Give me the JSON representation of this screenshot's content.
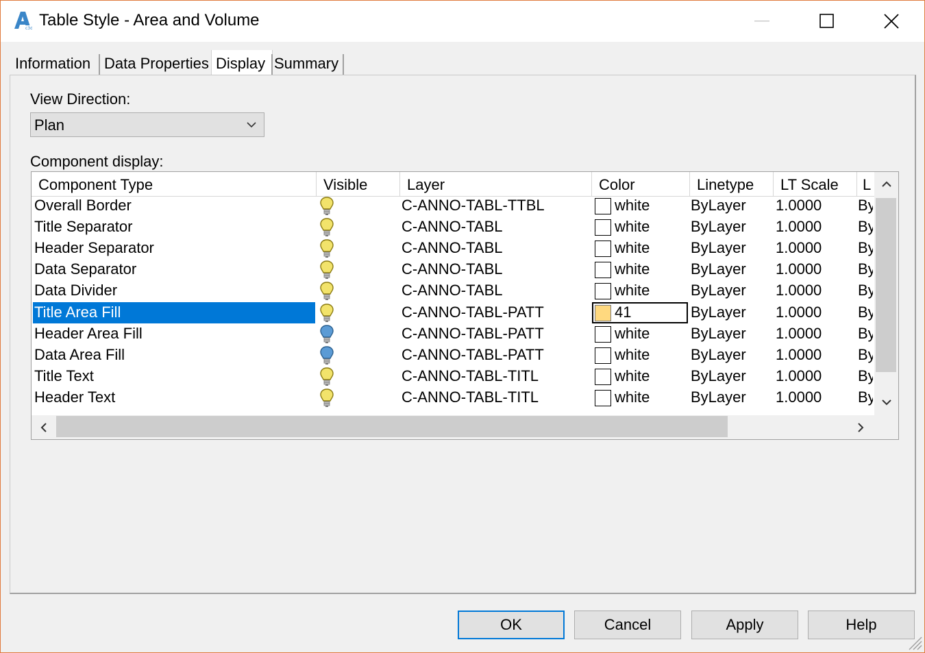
{
  "window": {
    "title": "Table Style - Area and Volume"
  },
  "tabs": [
    {
      "label": "Information"
    },
    {
      "label": "Data Properties"
    },
    {
      "label": "Display"
    },
    {
      "label": "Summary"
    }
  ],
  "active_tab": "Display",
  "view_direction": {
    "label": "View Direction:",
    "value": "Plan"
  },
  "component_display": {
    "label": "Component display:",
    "columns": [
      "Component Type",
      "Visible",
      "Layer",
      "Color",
      "Linetype",
      "LT Scale",
      "L"
    ],
    "rows": [
      {
        "type": "Overall Border",
        "visible": "on",
        "layer": "C-ANNO-TABL-TTBL",
        "color": "white",
        "linetype": "ByLayer",
        "lt_scale": "1.0000",
        "l": "By"
      },
      {
        "type": "Title Separator",
        "visible": "on",
        "layer": "C-ANNO-TABL",
        "color": "white",
        "linetype": "ByLayer",
        "lt_scale": "1.0000",
        "l": "By"
      },
      {
        "type": "Header Separator",
        "visible": "on",
        "layer": "C-ANNO-TABL",
        "color": "white",
        "linetype": "ByLayer",
        "lt_scale": "1.0000",
        "l": "By"
      },
      {
        "type": "Data Separator",
        "visible": "on",
        "layer": "C-ANNO-TABL",
        "color": "white",
        "linetype": "ByLayer",
        "lt_scale": "1.0000",
        "l": "By"
      },
      {
        "type": "Data Divider",
        "visible": "on",
        "layer": "C-ANNO-TABL",
        "color": "white",
        "linetype": "ByLayer",
        "lt_scale": "1.0000",
        "l": "By"
      },
      {
        "type": "Title Area Fill",
        "visible": "on",
        "layer": "C-ANNO-TABL-PATT",
        "color": "41",
        "linetype": "ByLayer",
        "lt_scale": "1.0000",
        "l": "By"
      },
      {
        "type": "Header Area Fill",
        "visible": "off",
        "layer": "C-ANNO-TABL-PATT",
        "color": "white",
        "linetype": "ByLayer",
        "lt_scale": "1.0000",
        "l": "By"
      },
      {
        "type": "Data Area Fill",
        "visible": "off",
        "layer": "C-ANNO-TABL-PATT",
        "color": "white",
        "linetype": "ByLayer",
        "lt_scale": "1.0000",
        "l": "By"
      },
      {
        "type": "Title Text",
        "visible": "on",
        "layer": "C-ANNO-TABL-TITL",
        "color": "white",
        "linetype": "ByLayer",
        "lt_scale": "1.0000",
        "l": "By"
      },
      {
        "type": "Header Text",
        "visible": "on",
        "layer": "C-ANNO-TABL-TITL",
        "color": "white",
        "linetype": "ByLayer",
        "lt_scale": "1.0000",
        "l": "By"
      }
    ],
    "selected_row": "Title Area Fill"
  },
  "buttons": {
    "ok": "OK",
    "cancel": "Cancel",
    "apply": "Apply",
    "help": "Help"
  },
  "colors": {
    "selection": "#0078d7",
    "color_41_swatch": "#ffd97f",
    "white_swatch": "#ffffff",
    "bulb_on": "#f2e36b",
    "bulb_off": "#5b9bd5"
  }
}
